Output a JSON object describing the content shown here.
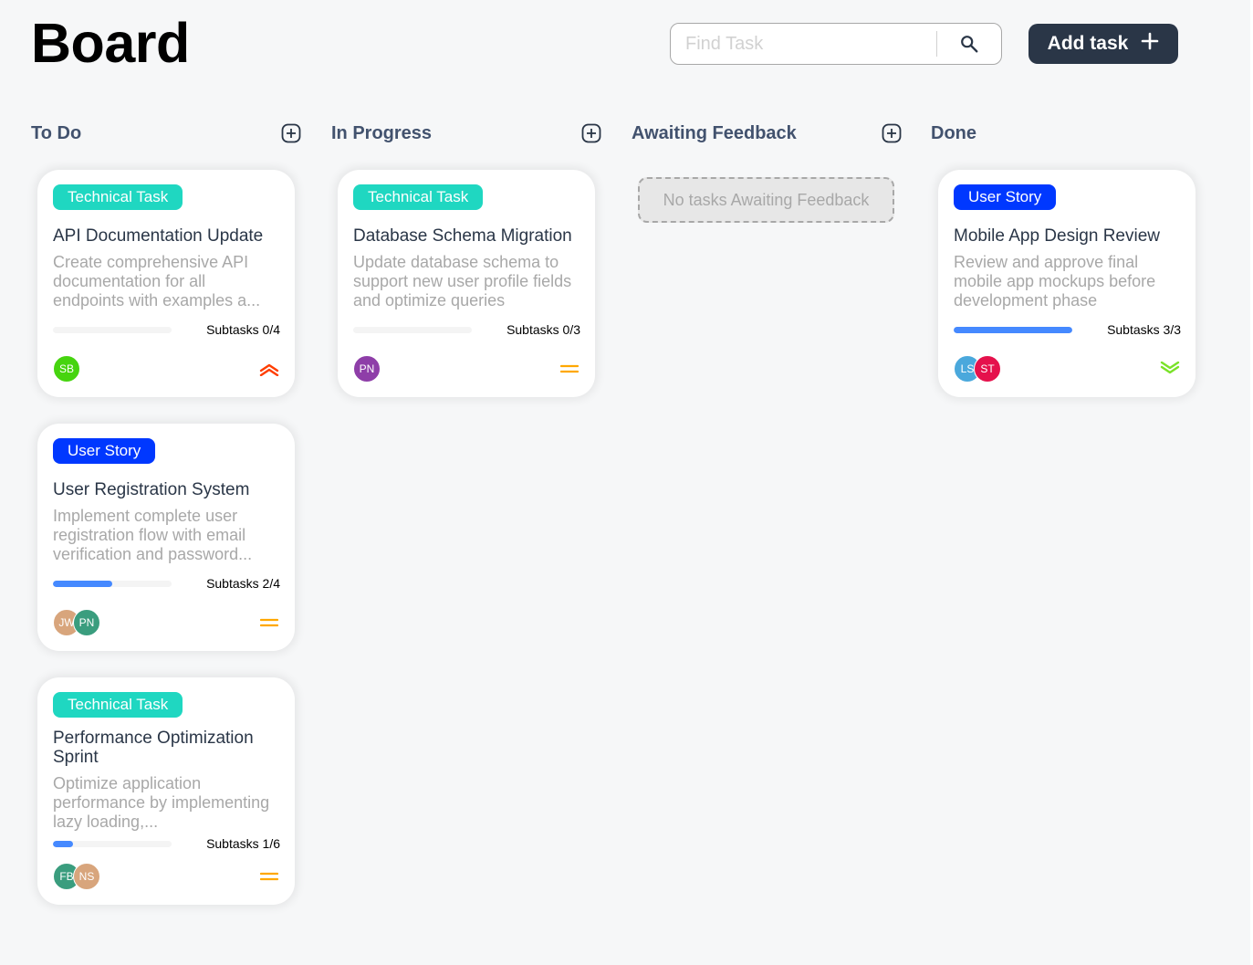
{
  "page": {
    "title": "Board"
  },
  "search": {
    "placeholder": "Find Task"
  },
  "add_task": {
    "label": "Add task"
  },
  "columns": [
    {
      "title": "To Do",
      "has_add": true
    },
    {
      "title": "In Progress",
      "has_add": true
    },
    {
      "title": "Awaiting Feedback",
      "has_add": true,
      "empty_text": "No tasks Awaiting Feedback"
    },
    {
      "title": "Done",
      "has_add": false
    }
  ],
  "colors": {
    "technical_task": "#1fd7c1",
    "user_story": "#0038ff",
    "progress": "#4589ff",
    "priority_urgent": "#ff3d00",
    "priority_medium": "#ffa800",
    "priority_low": "#7ae229",
    "primary_dark": "#2a3647"
  },
  "cards": [
    {
      "column": "To Do",
      "category": "Technical Task",
      "title": "API Documentation Update",
      "description": "Create comprehensive API documentation for all endpoints with examples a...",
      "subtasks_label": "Subtasks 0/4",
      "progress": 0.0,
      "assignees": [
        {
          "initials": "SB",
          "color": "#46d40f"
        }
      ],
      "priority": "urgent",
      "priority_icon": "chevrons-up-icon"
    },
    {
      "column": "To Do",
      "category": "User Story",
      "title": "User Registration System",
      "description": "Implement complete user registration flow with email verification and password...",
      "subtasks_label": "Subtasks 2/4",
      "progress": 0.5,
      "assignees": [
        {
          "initials": "JW",
          "color": "#d8a57c"
        },
        {
          "initials": "PN",
          "color": "#3a9d7e"
        }
      ],
      "priority": "medium",
      "priority_icon": "equals-icon"
    },
    {
      "column": "To Do",
      "category": "Technical Task",
      "title": "Performance Optimization Sprint",
      "description": "Optimize application performance by implementing lazy loading,...",
      "subtasks_label": "Subtasks 1/6",
      "progress": 0.1667,
      "assignees": [
        {
          "initials": "FB",
          "color": "#3a9d7e"
        },
        {
          "initials": "NS",
          "color": "#d8a57c"
        }
      ],
      "priority": "medium",
      "priority_icon": "equals-icon"
    },
    {
      "column": "In Progress",
      "category": "Technical Task",
      "title": "Database Schema Migration",
      "description": "Update database schema to support new user profile fields and optimize queries",
      "subtasks_label": "Subtasks 0/3",
      "progress": 0.0,
      "assignees": [
        {
          "initials": "PN",
          "color": "#8e3ea8"
        }
      ],
      "priority": "medium",
      "priority_icon": "equals-icon"
    },
    {
      "column": "Done",
      "category": "User Story",
      "title": "Mobile App Design Review",
      "description": "Review and approve final mobile app mockups before development phase",
      "subtasks_label": "Subtasks 3/3",
      "progress": 1.0,
      "assignees": [
        {
          "initials": "LS",
          "color": "#4aa8dc"
        },
        {
          "initials": "ST",
          "color": "#e5114c"
        }
      ],
      "priority": "low",
      "priority_icon": "chevrons-down-icon"
    }
  ]
}
